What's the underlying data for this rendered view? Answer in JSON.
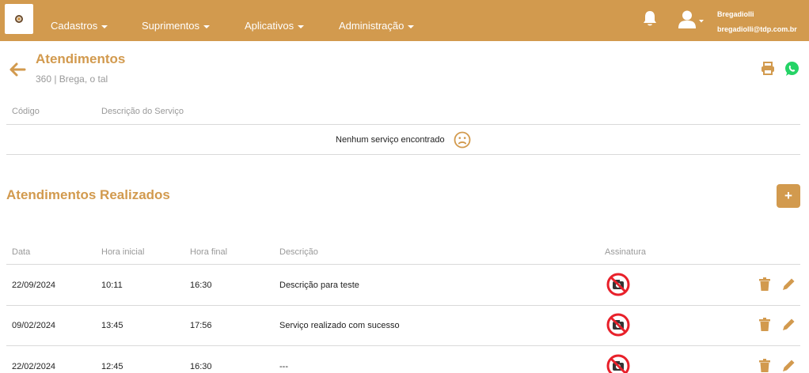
{
  "colors": {
    "accent": "#D29A4E",
    "header_text": "#ffffff",
    "muted_text": "#999999",
    "no_signature_icon": "#E8202A",
    "whatsapp": "#25D366"
  },
  "nav": {
    "logo_icon": "company-logo",
    "items": [
      {
        "label": "Cadastros"
      },
      {
        "label": "Suprimentos"
      },
      {
        "label": "Aplicativos"
      },
      {
        "label": "Administração"
      }
    ],
    "notification_icon": "bell-icon",
    "user": {
      "icon": "user-icon",
      "name": "Bregadiolli",
      "email": "bregadiolli@tdp.com.br"
    }
  },
  "page": {
    "title": "Atendimentos",
    "subtitle": "360 | Brega, o tal",
    "actions": {
      "print_icon": "print-icon",
      "whatsapp_icon": "whatsapp-icon"
    }
  },
  "services": {
    "columns": [
      "Código",
      "Descrição do Serviço"
    ],
    "empty_message": "Nenhum serviço encontrado",
    "empty_icon": "sad-face-icon"
  },
  "completed": {
    "title": "Atendimentos Realizados",
    "add_label": "+",
    "columns": [
      "Data",
      "Hora inicial",
      "Hora final",
      "Descrição",
      "Assinatura"
    ],
    "rows": [
      {
        "date": "22/09/2024",
        "start": "10:11",
        "end": "16:30",
        "description": "Descrição para teste",
        "signature_icon": "no-photo-icon"
      },
      {
        "date": "09/02/2024",
        "start": "13:45",
        "end": "17:56",
        "description": "Serviço realizado com sucesso",
        "signature_icon": "no-photo-icon"
      },
      {
        "date": "22/02/2024",
        "start": "12:45",
        "end": "16:30",
        "description": "---",
        "signature_icon": "no-photo-icon"
      }
    ],
    "row_actions": {
      "delete_icon": "trash-icon",
      "edit_icon": "pencil-icon"
    }
  }
}
